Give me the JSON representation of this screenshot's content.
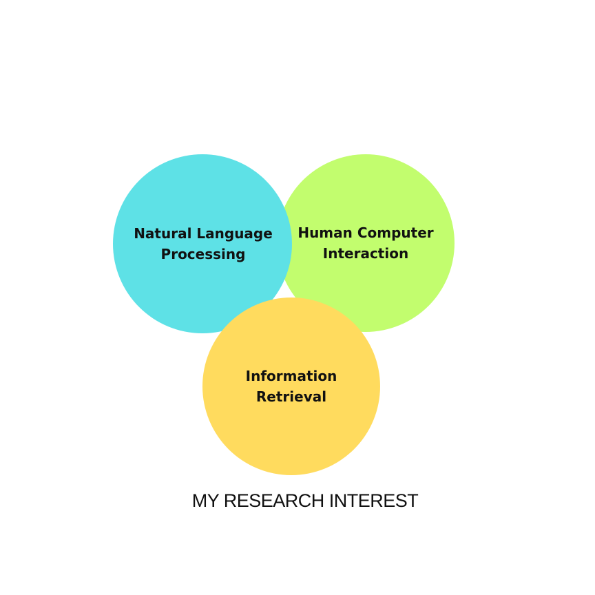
{
  "diagram": {
    "circles": [
      {
        "id": "hci",
        "label": "Human Computer\nInteraction",
        "color": "#c2fd6e"
      },
      {
        "id": "nlp",
        "label": "Natural Language\nProcessing",
        "color": "#5ee1e6"
      },
      {
        "id": "ir",
        "label": "Information\nRetrieval",
        "color": "#ffdb5e"
      }
    ],
    "caption": "MY RESEARCH INTEREST"
  }
}
